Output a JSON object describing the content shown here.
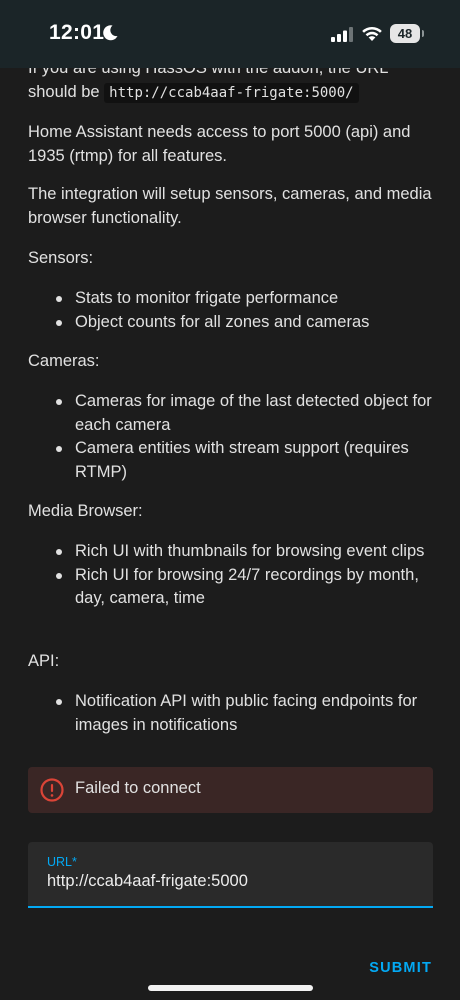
{
  "status_bar": {
    "time": "12:01",
    "battery": "48"
  },
  "intro": {
    "line_partial": "If you are using HassOS with the addon, the URL",
    "line_prefix": "should be",
    "url_code": "http://ccab4aaf-frigate:5000/"
  },
  "ports_text": "Home Assistant needs access to port 5000 (api) and 1935 (rtmp) for all features.",
  "integration_text": "The integration will setup sensors, cameras, and media browser functionality.",
  "sections": {
    "sensors": {
      "heading": "Sensors:",
      "items": [
        "Stats to monitor frigate performance",
        "Object counts for all zones and cameras"
      ]
    },
    "cameras": {
      "heading": "Cameras:",
      "items": [
        "Cameras for image of the last detected object for each camera",
        "Camera entities with stream support (requires RTMP)"
      ]
    },
    "media_browser": {
      "heading": "Media Browser:",
      "items": [
        "Rich UI with thumbnails for browsing event clips",
        "Rich UI for browsing 24/7 recordings by month, day, camera, time"
      ]
    },
    "api": {
      "heading": "API:",
      "items": [
        "Notification API with public facing endpoints for images in notifications"
      ]
    }
  },
  "alert": {
    "message": "Failed to connect",
    "color": "#db4437"
  },
  "url_field": {
    "label": "URL*",
    "value": "http://ccab4aaf-frigate:5000"
  },
  "submit_label": "SUBMIT",
  "accent_color": "#03a9f4"
}
